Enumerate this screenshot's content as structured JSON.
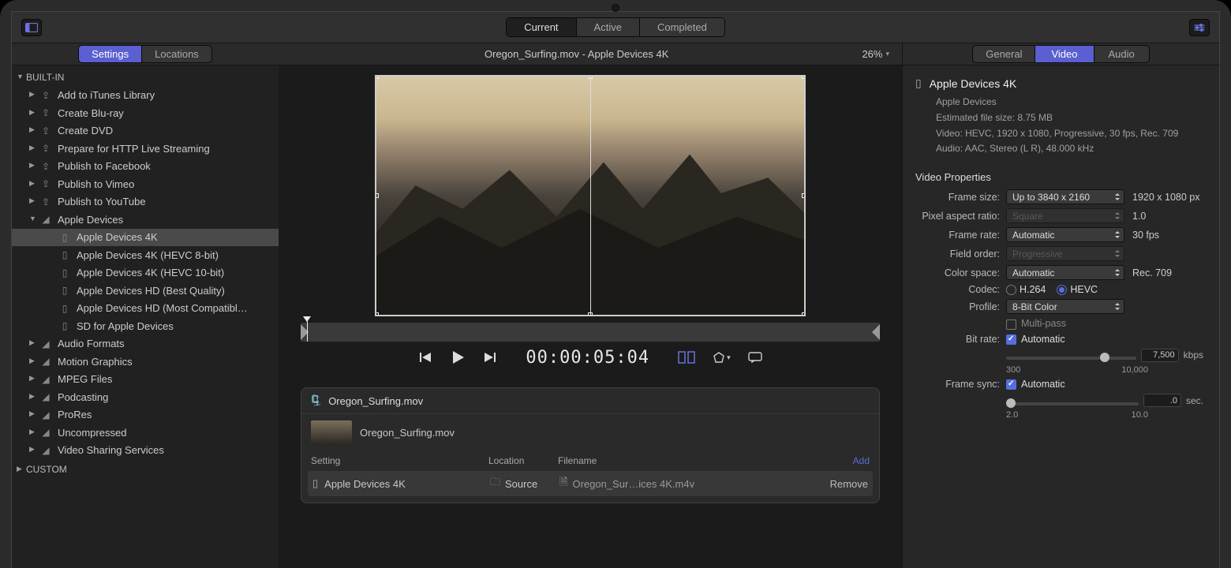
{
  "toolbar": {
    "tabs": {
      "current": "Current",
      "active": "Active",
      "completed": "Completed"
    }
  },
  "sidebar": {
    "tabs": {
      "settings": "Settings",
      "locations": "Locations"
    },
    "builtin_label": "BUILT-IN",
    "custom_label": "CUSTOM",
    "items": {
      "add_to_itunes": "Add to iTunes Library",
      "create_bluray": "Create Blu-ray",
      "create_dvd": "Create DVD",
      "prepare_http": "Prepare for HTTP Live Streaming",
      "publish_fb": "Publish to Facebook",
      "publish_vimeo": "Publish to Vimeo",
      "publish_yt": "Publish to YouTube",
      "apple_devices": "Apple Devices",
      "ad_4k": "Apple Devices 4K",
      "ad_4k_hevc8": "Apple Devices 4K (HEVC 8-bit)",
      "ad_4k_hevc10": "Apple Devices 4K (HEVC 10-bit)",
      "ad_hd_best": "Apple Devices HD (Best Quality)",
      "ad_hd_compat": "Apple Devices HD (Most Compatibl…",
      "ad_sd": "SD for Apple Devices",
      "audio_formats": "Audio Formats",
      "motion_graphics": "Motion Graphics",
      "mpeg_files": "MPEG Files",
      "podcasting": "Podcasting",
      "prores": "ProRes",
      "uncompressed": "Uncompressed",
      "video_sharing": "Video Sharing Services"
    }
  },
  "center": {
    "title": "Oregon_Surfing.mov - Apple Devices 4K",
    "zoom": "26%",
    "timecode": "00:00:05:04",
    "batch": {
      "group": "Oregon_Surfing.mov",
      "file": "Oregon_Surfing.mov",
      "headers": {
        "setting": "Setting",
        "location": "Location",
        "filename": "Filename",
        "add": "Add"
      },
      "row": {
        "setting": "Apple Devices 4K",
        "location": "Source",
        "filename": "Oregon_Sur…ices 4K.m4v",
        "remove": "Remove"
      }
    }
  },
  "inspector": {
    "tabs": {
      "general": "General",
      "video": "Video",
      "audio": "Audio"
    },
    "title": "Apple Devices 4K",
    "subtitle": "Apple Devices",
    "est_size": "Estimated file size: 8.75 MB",
    "video_line": "Video: HEVC, 1920 x 1080, Progressive, 30 fps, Rec. 709",
    "audio_line": "Audio: AAC, Stereo (L R), 48.000 kHz",
    "section": "Video Properties",
    "labels": {
      "frame_size": "Frame size:",
      "par": "Pixel aspect ratio:",
      "frame_rate": "Frame rate:",
      "field_order": "Field order:",
      "color_space": "Color space:",
      "codec": "Codec:",
      "profile": "Profile:",
      "multipass": "Multi-pass",
      "bit_rate": "Bit rate:",
      "frame_sync": "Frame sync:"
    },
    "values": {
      "frame_size_sel": "Up to 3840 x 2160",
      "frame_size_res": "1920 x 1080 px",
      "par_sel": "Square",
      "par_val": "1.0",
      "frame_rate_sel": "Automatic",
      "frame_rate_val": "30 fps",
      "field_order_sel": "Progressive",
      "color_space_sel": "Automatic",
      "color_space_val": "Rec. 709",
      "codec_h264": "H.264",
      "codec_hevc": "HEVC",
      "profile_sel": "8-Bit Color",
      "bit_rate_auto": "Automatic",
      "bit_rate_num": "7,500",
      "bit_rate_unit": "kbps",
      "bit_rate_min": "300",
      "bit_rate_max": "10,000",
      "frame_sync_auto": "Automatic",
      "frame_sync_num": ".0",
      "frame_sync_unit": "sec.",
      "frame_sync_min": "2.0",
      "frame_sync_max": "10.0"
    }
  }
}
